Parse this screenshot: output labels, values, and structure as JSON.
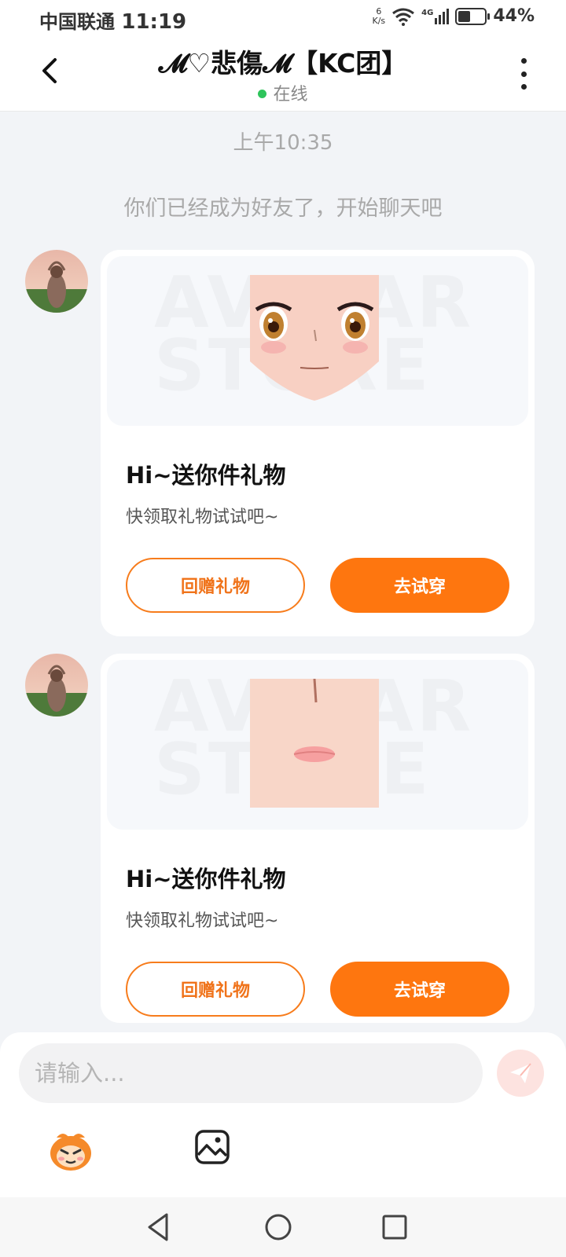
{
  "status_bar": {
    "carrier": "中国联通",
    "time": "11:19",
    "net_speed_value": "6",
    "net_speed_unit": "K/s",
    "signal": "4G",
    "battery": "44%",
    "battery_level": 0.44
  },
  "header": {
    "title": "𝓜♡悲傷𝓜【KC团】",
    "status": "在线",
    "status_color": "#2ec45b"
  },
  "chat": {
    "timestamp": "上午10:35",
    "system_message": "你们已经成为好友了，开始聊天吧",
    "watermark": "AVATAR STORE",
    "messages": [
      {
        "title": "Hi~送你件礼物",
        "subtitle": "快领取礼物试试吧~",
        "return_gift_label": "回赠礼物",
        "try_on_label": "去试穿",
        "item": "face-eyes"
      },
      {
        "title": "Hi~送你件礼物",
        "subtitle": "快领取礼物试试吧~",
        "return_gift_label": "回赠礼物",
        "try_on_label": "去试穿",
        "item": "face-lips"
      }
    ]
  },
  "input": {
    "placeholder": "请输入..."
  },
  "colors": {
    "accent": "#fe760f",
    "background": "#f2f4f7"
  },
  "icons": {
    "back": "chevron-left-icon",
    "more": "more-vertical-icon",
    "send": "send-icon",
    "mascot": "mascot-emoji-icon",
    "image": "image-icon",
    "nav_back": "triangle-back-icon",
    "nav_home": "circle-home-icon",
    "nav_recent": "square-recent-icon"
  }
}
